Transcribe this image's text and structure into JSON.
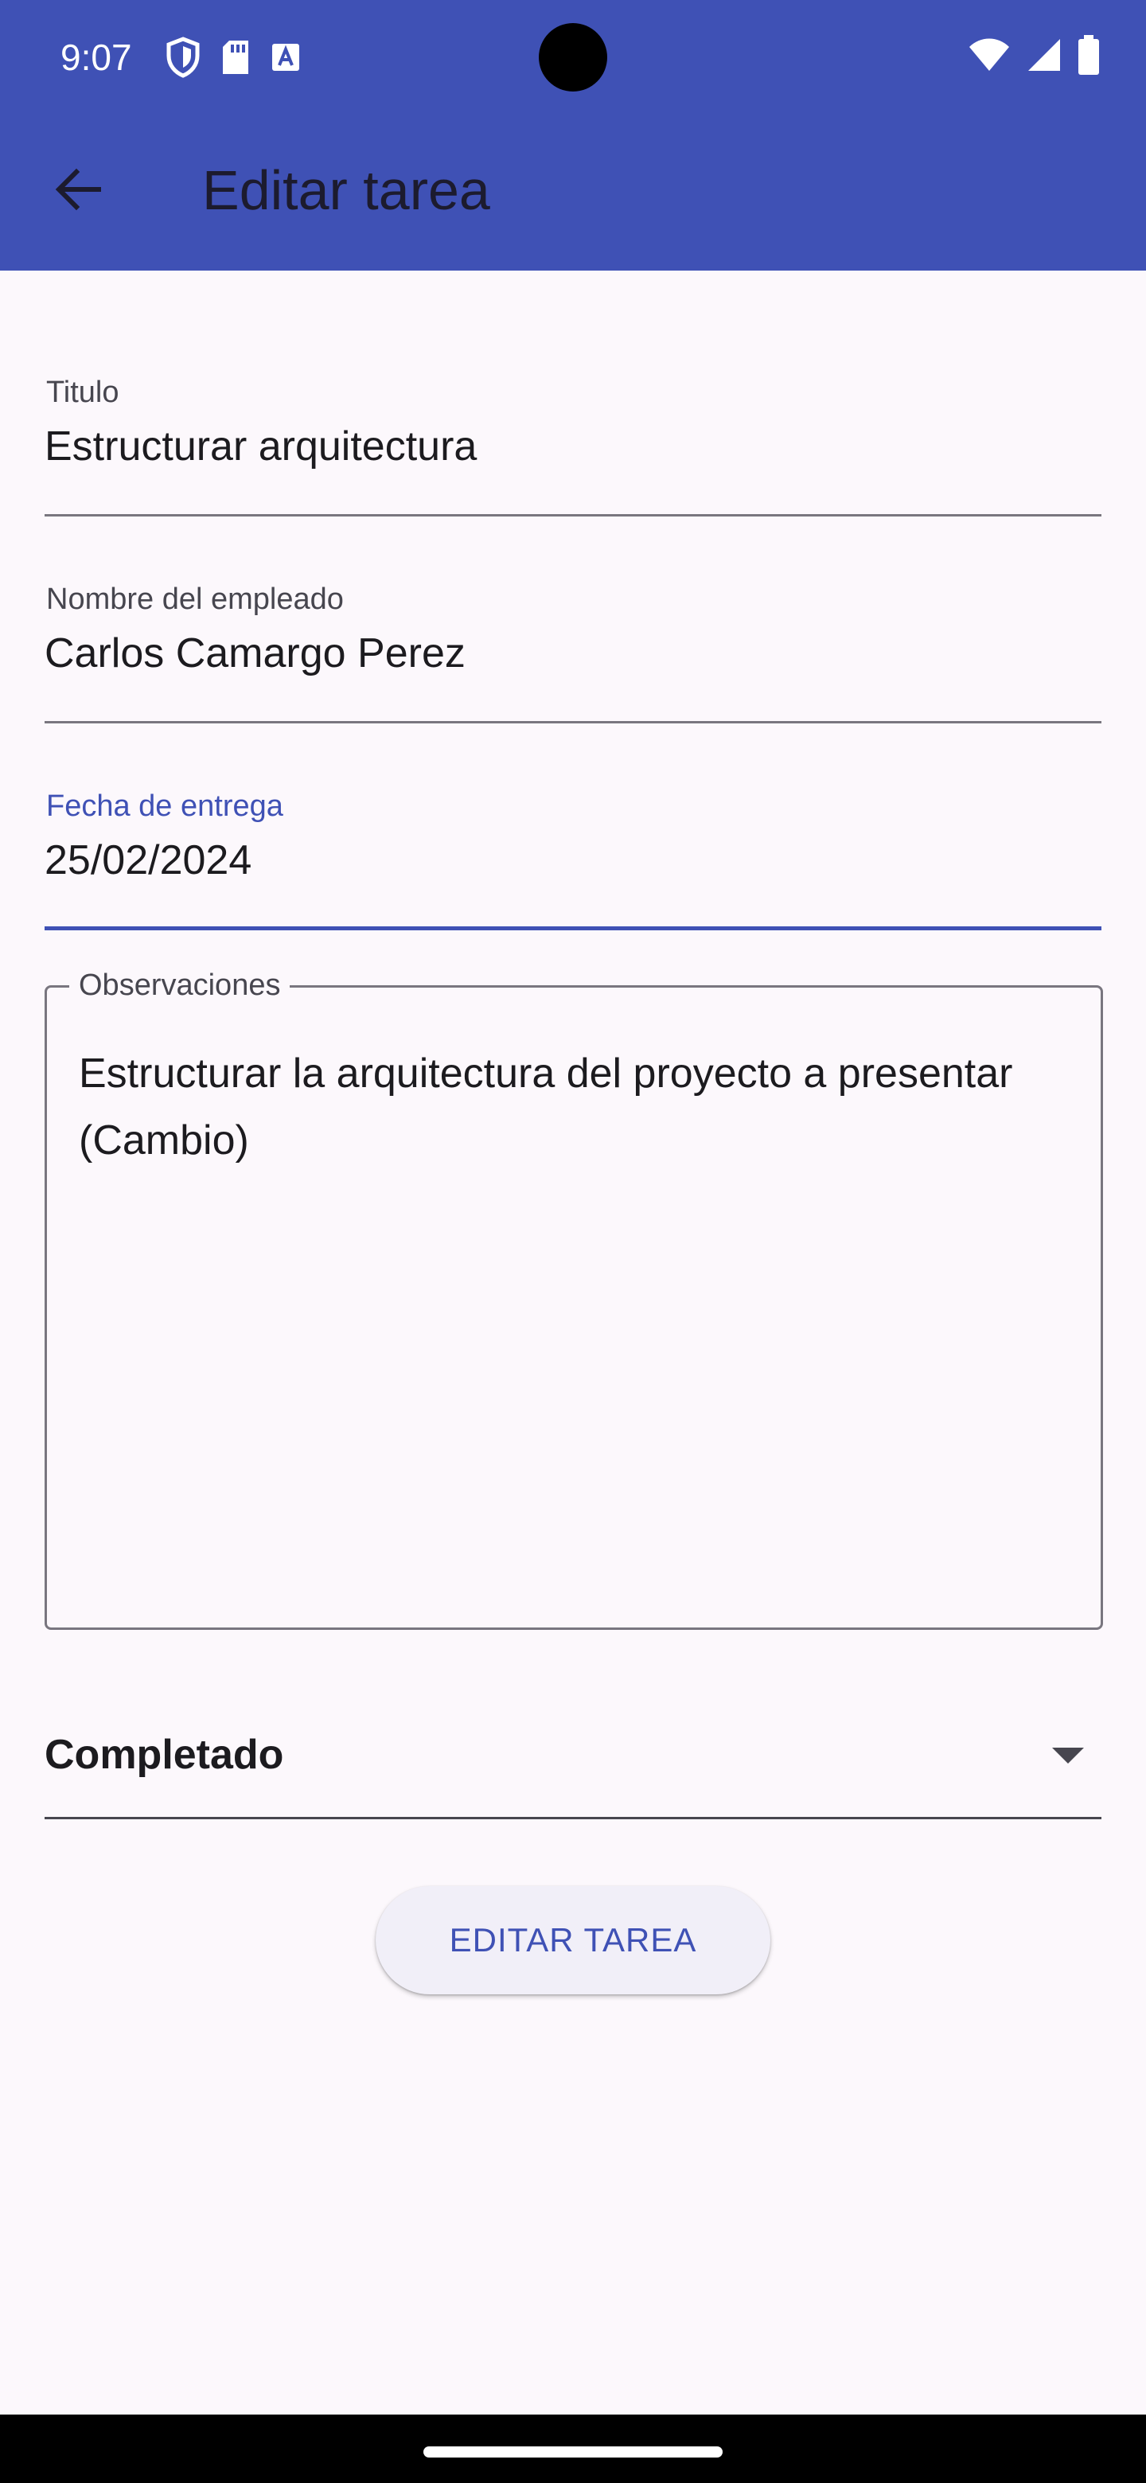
{
  "status_bar": {
    "time": "9:07",
    "icons": [
      "shield-icon",
      "sd-card-icon",
      "font-a-icon",
      "wifi-icon",
      "signal-icon",
      "battery-icon"
    ]
  },
  "app_bar": {
    "title": "Editar tarea",
    "back_icon": "arrow-back-icon",
    "color": "#3f51b5"
  },
  "form": {
    "titulo": {
      "label": "Titulo",
      "value": "Estructurar arquitectura"
    },
    "empleado": {
      "label": "Nombre del empleado",
      "value": "Carlos Camargo Perez"
    },
    "fecha": {
      "label": "Fecha de entrega",
      "value": "25/02/2024",
      "focused": true
    },
    "observaciones": {
      "label": "Observaciones",
      "value": "Estructurar la arquitectura del proyecto a presentar (Cambio)"
    },
    "estado": {
      "selected": "Completado"
    }
  },
  "submit_button": {
    "label": "EDITAR TAREA"
  }
}
